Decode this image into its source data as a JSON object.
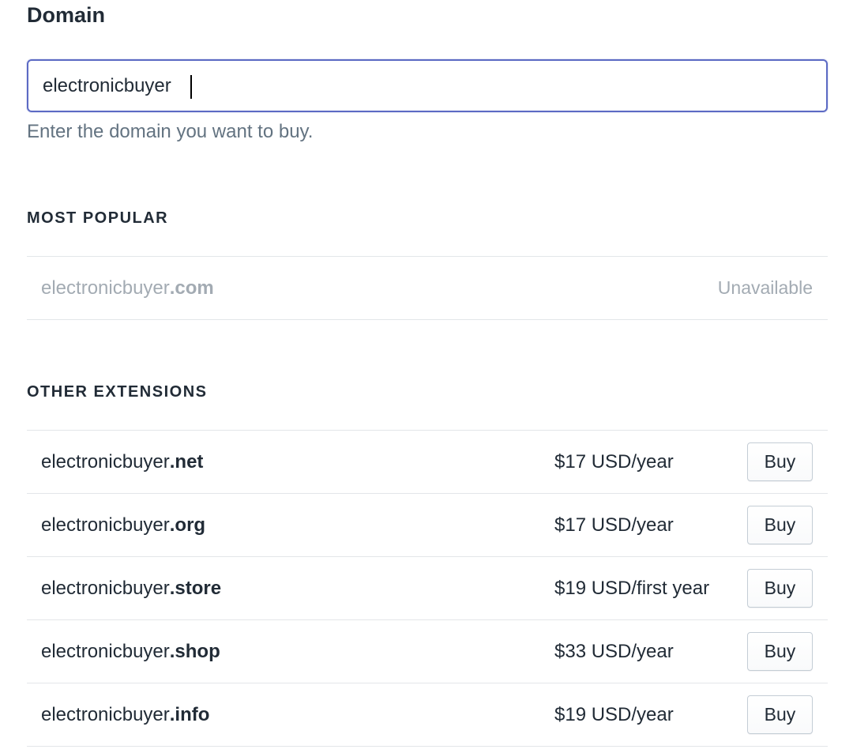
{
  "form": {
    "label": "Domain",
    "input_value": "electronicbuyer",
    "help_text": "Enter the domain you want to buy."
  },
  "most_popular": {
    "heading": "MOST POPULAR",
    "items": [
      {
        "base": "electronicbuyer",
        "ext": ".com",
        "status": "Unavailable"
      }
    ]
  },
  "other_extensions": {
    "heading": "OTHER EXTENSIONS",
    "buy_label": "Buy",
    "items": [
      {
        "base": "electronicbuyer",
        "ext": ".net",
        "price": "$17 USD/year",
        "buy": "Buy"
      },
      {
        "base": "electronicbuyer",
        "ext": ".org",
        "price": "$17 USD/year",
        "buy": "Buy"
      },
      {
        "base": "electronicbuyer",
        "ext": ".store",
        "price": "$19 USD/first year",
        "buy": "Buy"
      },
      {
        "base": "electronicbuyer",
        "ext": ".shop",
        "price": "$33 USD/year",
        "buy": "Buy"
      },
      {
        "base": "electronicbuyer",
        "ext": ".info",
        "price": "$19 USD/year",
        "buy": "Buy"
      }
    ]
  },
  "colors": {
    "focus_border": "#5c6ac4",
    "text": "#212b36",
    "muted": "#637381",
    "disabled": "#a3abb3",
    "divider": "#e3e6e9"
  }
}
